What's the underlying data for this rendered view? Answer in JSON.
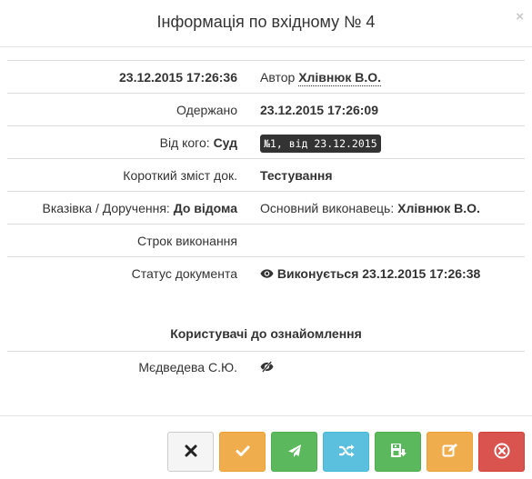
{
  "header": {
    "title": "Інформація по вхідному № 4",
    "close_symbol": "×"
  },
  "rows": {
    "created": {
      "datetime": "23.12.2015 17:26:36",
      "author_label": "Автор",
      "author": "Хлівнюк В.О."
    },
    "received": {
      "label": "Одержано",
      "value": "23.12.2015 17:26:09"
    },
    "from": {
      "label": "Від кого:",
      "value": "Суд",
      "badge": "№1, від 23.12.2015"
    },
    "summary": {
      "label": "Короткий зміст док.",
      "value": "Тестування"
    },
    "instruction": {
      "label": "Вказівка / Доручення:",
      "value": "До відома",
      "executor_label": "Основний виконавець:",
      "executor": "Хлівнюк В.О."
    },
    "deadline": {
      "label": "Строк виконання",
      "value": ""
    },
    "status": {
      "label": "Статус документа",
      "value": "Виконується 23.12.2015 17:26:38",
      "icon": "eye-icon"
    }
  },
  "acquaint": {
    "title": "Користувачі до ознайомлення",
    "users": [
      {
        "name": "Мєдведева С.Ю.",
        "icon": "eye-slash-icon"
      }
    ]
  },
  "footer": {
    "buttons": [
      {
        "name": "close-button",
        "icon": "close-icon",
        "style": "default"
      },
      {
        "name": "confirm-button",
        "icon": "check-icon",
        "style": "warning"
      },
      {
        "name": "send-button",
        "icon": "send-icon",
        "style": "success"
      },
      {
        "name": "redirect-button",
        "icon": "shuffle-icon",
        "style": "info"
      },
      {
        "name": "save-button",
        "icon": "save-download-icon",
        "style": "success"
      },
      {
        "name": "edit-button",
        "icon": "edit-icon",
        "style": "warning"
      },
      {
        "name": "delete-button",
        "icon": "remove-circle-icon",
        "style": "danger"
      }
    ]
  },
  "colors": {
    "default": "#f5f5f5",
    "warning": "#f0ad4e",
    "success": "#5cb85c",
    "info": "#5bc0de",
    "danger": "#d9534f",
    "badge": "#333333"
  }
}
